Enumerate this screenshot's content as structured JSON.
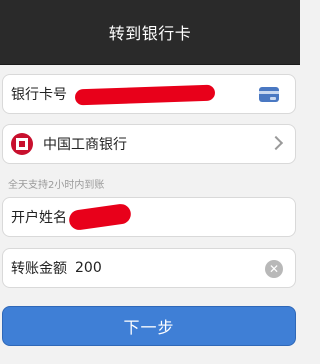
{
  "header": {
    "title": "转到银行卡"
  },
  "form": {
    "card_number": {
      "label": "银行卡号",
      "icon": "bank-card-icon"
    },
    "bank": {
      "name": "中国工商银行",
      "icon": "icbc-logo-icon"
    },
    "hint": "全天支持2小时内到账",
    "account_name": {
      "label": "开户姓名"
    },
    "amount": {
      "label": "转账金额",
      "value": "200",
      "clear_icon": "clear-icon"
    }
  },
  "actions": {
    "next_label": "下一步"
  },
  "colors": {
    "header_bg": "#2a2a2a",
    "button_bg": "#3f7fd6",
    "redaction": "#e8001a",
    "bank_red": "#c8102e"
  }
}
